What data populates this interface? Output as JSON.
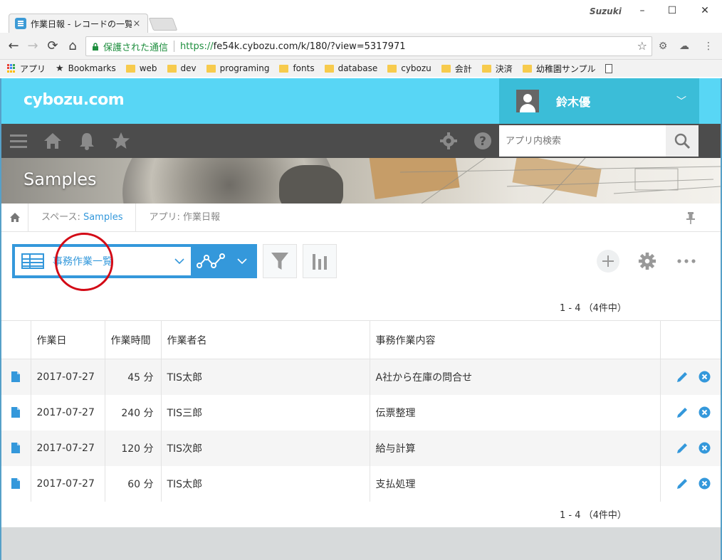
{
  "browser": {
    "tab_title": "作業日報 - レコードの一覧",
    "tab_close": "×",
    "profile": "Suzuki",
    "minimize": "–",
    "maximize": "☐",
    "close": "✕",
    "secure_label": "保護された通信",
    "url_scheme": "https://",
    "url_rest": "fe54k.cybozu.com/k/180/?view=5317971",
    "bookmarks": [
      {
        "label": "アプリ",
        "icon": "apps-grid-icon"
      },
      {
        "label": "Bookmarks",
        "icon": "star-icon"
      },
      {
        "label": "web",
        "icon": "folder-icon"
      },
      {
        "label": "dev",
        "icon": "folder-icon"
      },
      {
        "label": "programing",
        "icon": "folder-icon"
      },
      {
        "label": "fonts",
        "icon": "folder-icon"
      },
      {
        "label": "database",
        "icon": "folder-icon"
      },
      {
        "label": "cybozu",
        "icon": "folder-icon"
      },
      {
        "label": "会計",
        "icon": "folder-icon"
      },
      {
        "label": "決済",
        "icon": "folder-icon"
      },
      {
        "label": "幼稚園サンプル",
        "icon": "folder-icon"
      }
    ]
  },
  "header": {
    "brand": "cybozu.com",
    "user_name": "鈴木優",
    "search_placeholder": "アプリ内検索"
  },
  "banner": {
    "title": "Samples"
  },
  "breadcrumb": {
    "space_prefix": "スペース: ",
    "space_name": "Samples",
    "app": "アプリ: 作業日報"
  },
  "view": {
    "name": "事務作業一覧"
  },
  "pager": {
    "top": "1 - 4 （4件中）",
    "bottom": "1 - 4 （4件中）"
  },
  "table": {
    "columns": [
      "作業日",
      "作業時間",
      "作業者名",
      "事務作業内容"
    ],
    "rows": [
      {
        "date": "2017-07-27",
        "hours": "45 分",
        "worker": "TIS太郎",
        "task": "A社から在庫の問合せ"
      },
      {
        "date": "2017-07-27",
        "hours": "240 分",
        "worker": "TIS三郎",
        "task": "伝票整理"
      },
      {
        "date": "2017-07-27",
        "hours": "120 分",
        "worker": "TIS次郎",
        "task": "給与計算"
      },
      {
        "date": "2017-07-27",
        "hours": "60 分",
        "worker": "TIS太郎",
        "task": "支払処理"
      }
    ]
  },
  "colors": {
    "header": "#58d6f5",
    "user_box": "#3bbdd8",
    "nav": "#4c4c4c",
    "accent": "#3498db",
    "annotation": "#d30a16"
  }
}
